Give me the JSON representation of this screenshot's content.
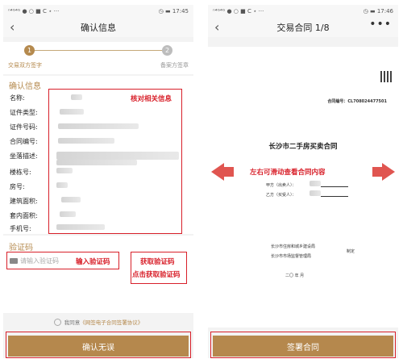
{
  "left": {
    "status_left": "ⁿ⁴ᴳ⁴ᴳ ● ○ ■ C ⋆ ···",
    "status_right": "◷ ▬ 17:45",
    "back_icon": "‹",
    "title": "确认信息",
    "steps": {
      "step1_number": "1",
      "step1_label": "交易双方签字",
      "step2_number": "2",
      "step2_label": "备案方签章"
    },
    "info_title": "确认信息",
    "info_fields": [
      "名称:",
      "证件类型:",
      "证件号码:",
      "合同编号:",
      "坐落描述:",
      "楼栋号:",
      "房号:",
      "建筑面积:",
      "套内面积:",
      "手机号:"
    ],
    "annotation_verify": "核对相关信息",
    "code_title": "验证码",
    "code_placeholder": "请输入验证码",
    "annotation_input": "输入验证码",
    "get_code_label": "获取验证码",
    "annotation_click": "点击获取验证码",
    "agree_prefix": "我同意",
    "agree_link": "《网签电子合同签署协议》",
    "confirm_button": "确认无误"
  },
  "right": {
    "status_left": "ⁿ⁴ᴳ⁴ᴳ ● ○ ■ C ⋆ ···",
    "status_right": "◷ ▬ 17:46",
    "back_icon": "‹",
    "title": "交易合同 1/8",
    "more_icon": "•••",
    "contract_no": "合同编号：CL708024477501",
    "doc_title": "长沙市二手房买卖合同",
    "party_a": "甲方（出卖人）：",
    "party_b": "乙方（买受人）：",
    "annotation_swipe": "左右可滑动查看合同内容",
    "issuer_1": "长沙市住房和城乡建设局",
    "issuer_2": "长沙市市场监督管理局",
    "issuer_made": "制定",
    "year_line": "二〇   年   月",
    "sign_button": "签署合同"
  },
  "colors": {
    "accent": "#b5884d",
    "annotation": "#d8202a"
  }
}
